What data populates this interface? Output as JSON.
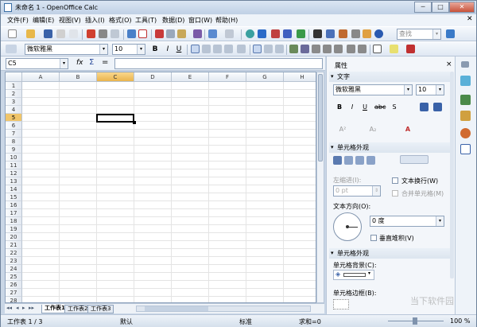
{
  "window": {
    "title": "未命名 1 - OpenOffice Calc",
    "min": "─",
    "max": "□",
    "close": "✕"
  },
  "menu": [
    "文件(F)",
    "编辑(E)",
    "视图(V)",
    "插入(I)",
    "格式(O)",
    "工具(T)",
    "数据(D)",
    "窗口(W)",
    "帮助(H)"
  ],
  "toolbar": {
    "search_placeholder": "查找"
  },
  "format": {
    "font_name": "微软雅黑",
    "font_size": "10",
    "bold": "B",
    "italic": "I",
    "underline": "U"
  },
  "formula": {
    "cell_ref": "C5",
    "fx": "fx",
    "sum": "Σ",
    "equals": "=",
    "value": ""
  },
  "sheet": {
    "columns": [
      "A",
      "B",
      "C",
      "D",
      "E",
      "F",
      "G",
      "H"
    ],
    "rows": [
      "1",
      "2",
      "3",
      "4",
      "5",
      "6",
      "7",
      "8",
      "9",
      "10",
      "11",
      "12",
      "13",
      "14",
      "15",
      "16",
      "17",
      "18",
      "19",
      "20",
      "21",
      "22",
      "23",
      "24",
      "25",
      "26",
      "27",
      "28"
    ],
    "selected_cell": "C5",
    "tabs": [
      "工作表1",
      "工作表2",
      "工作表3"
    ],
    "active_tab": "工作表1"
  },
  "status": {
    "sheet": "工作表 1 / 3",
    "style": "默认",
    "mode": "标准",
    "sum": "求和=0",
    "zoom": "100 %"
  },
  "sidebar": {
    "title": "属性",
    "close": "×",
    "text_section": "文字",
    "font_name": "微软雅黑",
    "font_size": "10",
    "align_section": "单元格外观",
    "indent_label": "左缩进(I):",
    "indent_value": "0 pt",
    "wrap_text": "文本换行(W)",
    "merge_cells": "合并单元格(M)",
    "text_direction": "文本方向(O):",
    "angle_value": "0 度",
    "vertical_stack": "垂直堆积(V)",
    "appearance_section": "单元格外观",
    "cell_bg": "单元格背景(C):",
    "cell_border": "单元格边框(B):"
  },
  "watermark": "当下软件园"
}
